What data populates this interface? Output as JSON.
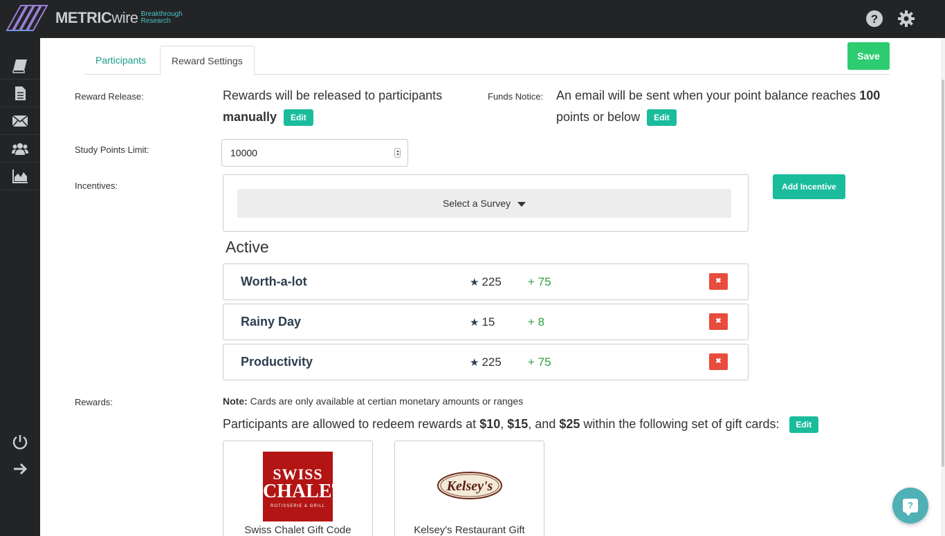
{
  "app": {
    "brand_bold": "METRIC",
    "brand_light": "wire",
    "tagline": "Breakthrough Research"
  },
  "colors": {
    "accent_teal": "#1abc9c",
    "save_green": "#2ecc71",
    "delete_red": "#e74c3c",
    "bonus_green": "#2f9e44",
    "sidebar_bg": "#222426"
  },
  "topbar_icons": [
    "help-icon",
    "gear-icon"
  ],
  "sidebar": {
    "items": [
      "book-icon",
      "document-icon",
      "envelope-icon",
      "users-icon",
      "chart-icon"
    ],
    "bottom": [
      "power-icon",
      "arrow-right-icon"
    ]
  },
  "tabs": [
    {
      "label": "Participants",
      "active": false
    },
    {
      "label": "Reward Settings",
      "active": true
    }
  ],
  "toolbar": {
    "save_label": "Save"
  },
  "reward_release": {
    "label": "Reward Release:",
    "text": "Rewards will be released to participants",
    "mode": "manually",
    "edit_label": "Edit"
  },
  "funds_notice": {
    "label": "Funds Notice:",
    "text_before": "An email will be sent when your point balance reaches",
    "threshold": "100",
    "text_after": "points or below",
    "edit_label": "Edit"
  },
  "study_points": {
    "label": "Study Points Limit:",
    "value": "10000"
  },
  "incentives": {
    "label": "Incentives:",
    "select_label": "Select a Survey",
    "add_label": "Add Incentive",
    "active_title": "Active",
    "items": [
      {
        "name": "Worth-a-lot",
        "points": "225",
        "bonus": "+ 75"
      },
      {
        "name": "Rainy Day",
        "points": "15",
        "bonus": "+ 8"
      },
      {
        "name": "Productivity",
        "points": "225",
        "bonus": "+ 75"
      }
    ],
    "delete_glyph": "✖"
  },
  "rewards": {
    "label": "Rewards:",
    "note_bold": "Note:",
    "note_text": " Cards are only available at certian monetary amounts or ranges",
    "redeem_prefix": "Participants are allowed to redeem rewards at ",
    "amount1": "$10",
    "sep1": ", ",
    "amount2": "$15",
    "sep2": ", and ",
    "amount3": "$25",
    "redeem_suffix": " within the following set of gift cards:",
    "edit_label": "Edit",
    "cards": [
      {
        "name": "Swiss Chalet Gift Code",
        "logo_l1": "SWISS",
        "logo_l2": "CHALET.",
        "logo_l3": "ROTISSERIE & GRILL"
      },
      {
        "name": "Kelsey's Restaurant Gift",
        "logo_text": "Kelsey's"
      }
    ]
  },
  "chat": {
    "glyph": "?"
  }
}
